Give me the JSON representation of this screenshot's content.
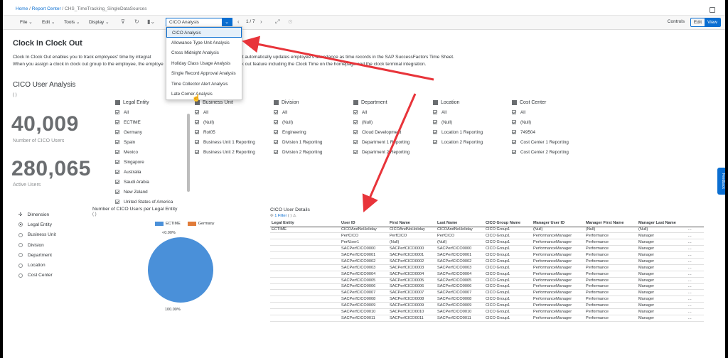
{
  "breadcrumb": {
    "home": "Home",
    "report_center": "Report Center",
    "current": "CHS_TimeTracking_SingleDataSources",
    "sep": "/"
  },
  "toolbar": {
    "file": "File",
    "edit": "Edit",
    "tools": "Tools",
    "display": "Display",
    "story_selected": "CICO Analysis",
    "page": "1 / 7",
    "controls": "Controls",
    "mode_edit": "Edit",
    "mode_view": "View"
  },
  "story_options": [
    "CICO Analysis",
    "Allowance Type Unit Analysis",
    "Cross Midnight Analysis",
    "Holiday Class Usage Analysis",
    "Single Record Approval Analysis",
    "Time Collector Alert Analysis",
    "Late Comer Analysis"
  ],
  "page_title": "Clock In Clock Out",
  "description": {
    "line1": "Clock In Clock Out enables you to track employees' time by integrat",
    "line1b": "vices. It automatically updates employee's attendance as time records in the SAP SuccessFactors Time Sheet.",
    "line2": "When you assign a clock in clock out group to the employee, the employe",
    "line2b": "ock out feature including the Clock Time on the homepage and the clock terminal integration."
  },
  "section_title": "CICO User Analysis",
  "paren": "( )",
  "kpis": [
    {
      "value": "40,009",
      "label": "Number of CICO Users"
    },
    {
      "value": "280,065",
      "label": "Active Users"
    }
  ],
  "filters": [
    {
      "title": "Legal Entity",
      "items": [
        "All",
        "ECTIME",
        "Germany",
        "Spain",
        "Mexico",
        "Singapore",
        "Australia",
        "Saudi Arabia",
        "New Zeland",
        "United States of America"
      ]
    },
    {
      "title": "Business Unit",
      "items": [
        "All",
        "(Null)",
        "Rot05",
        "Business Unit 1 Reporting",
        "Business Unit 2 Reporting"
      ]
    },
    {
      "title": "Division",
      "items": [
        "All",
        "(Null)",
        "Engineering",
        "Division 1 Reporting",
        "Division 2 Reporting"
      ]
    },
    {
      "title": "Department",
      "items": [
        "All",
        "(Null)",
        "Cloud Development",
        "Department 1 Reporting",
        "Department 2 Reporting"
      ]
    },
    {
      "title": "Location",
      "items": [
        "All",
        "(Null)",
        "Location 1 Reporting",
        "Location 2 Reporting"
      ]
    },
    {
      "title": "Cost Center",
      "items": [
        "All",
        "(Null)",
        "749504",
        "Cost Center 1 Reporting",
        "Cost Center 2 Reporting"
      ]
    }
  ],
  "dimension": {
    "title": "Dimension",
    "options": [
      "Legal Entity",
      "Business Unit",
      "Division",
      "Department",
      "Location",
      "Cost Center"
    ],
    "selected": 0
  },
  "chart_data": {
    "type": "pie",
    "title": "Number of CICO Users per Legal Entity",
    "subtitle": "( )",
    "categories": [
      "ECTIME",
      "Germany"
    ],
    "values": [
      100.0,
      0.0
    ],
    "labels": [
      "100.00%",
      "<0.00%"
    ],
    "colors": [
      "#4a90d9",
      "#e07b39"
    ]
  },
  "table": {
    "title": "CICO User Details",
    "filter_text": "1 Filter",
    "columns": [
      "Legal Entity",
      "User ID",
      "First Name",
      "Last Name",
      "CICO Group Name",
      "Manager User ID",
      "Manager First Name",
      "Manager Last Name",
      ""
    ],
    "rows": [
      [
        "ECTIME",
        "CICOAndNoHoliday",
        "CICOAndNoHoliday",
        "CICOAndNoHoliday",
        "CICO Group1",
        "(Null)",
        "(Null)",
        "(Null)",
        "..."
      ],
      [
        "",
        "PerfCICO",
        "PerfCICO",
        "PerfCICO",
        "CICO Group1",
        "PerformanceManager",
        "Performance",
        "Manager",
        "..."
      ],
      [
        "",
        "PerfUser1",
        "(Null)",
        "(Null)",
        "CICO Group1",
        "PerformanceManager",
        "Performance",
        "Manager",
        "..."
      ],
      [
        "",
        "SACPerfCICO0000",
        "SACPerfCICO0000",
        "SACPerfCICO0000",
        "CICO Group1",
        "PerformanceManager",
        "Performance",
        "Manager",
        "..."
      ],
      [
        "",
        "SACPerfCICO0001",
        "SACPerfCICO0001",
        "SACPerfCICO0001",
        "CICO Group1",
        "PerformanceManager",
        "Performance",
        "Manager",
        "..."
      ],
      [
        "",
        "SACPerfCICO0002",
        "SACPerfCICO0002",
        "SACPerfCICO0002",
        "CICO Group1",
        "PerformanceManager",
        "Performance",
        "Manager",
        "..."
      ],
      [
        "",
        "SACPerfCICO0003",
        "SACPerfCICO0003",
        "SACPerfCICO0003",
        "CICO Group1",
        "PerformanceManager",
        "Performance",
        "Manager",
        "..."
      ],
      [
        "",
        "SACPerfCICO0004",
        "SACPerfCICO0004",
        "SACPerfCICO0004",
        "CICO Group1",
        "PerformanceManager",
        "Performance",
        "Manager",
        "..."
      ],
      [
        "",
        "SACPerfCICO0005",
        "SACPerfCICO0005",
        "SACPerfCICO0005",
        "CICO Group1",
        "PerformanceManager",
        "Performance",
        "Manager",
        "..."
      ],
      [
        "",
        "SACPerfCICO0006",
        "SACPerfCICO0006",
        "SACPerfCICO0006",
        "CICO Group1",
        "PerformanceManager",
        "Performance",
        "Manager",
        "..."
      ],
      [
        "",
        "SACPerfCICO0007",
        "SACPerfCICO0007",
        "SACPerfCICO0007",
        "CICO Group1",
        "PerformanceManager",
        "Performance",
        "Manager",
        "..."
      ],
      [
        "",
        "SACPerfCICO0008",
        "SACPerfCICO0008",
        "SACPerfCICO0008",
        "CICO Group1",
        "PerformanceManager",
        "Performance",
        "Manager",
        "..."
      ],
      [
        "",
        "SACPerfCICO0009",
        "SACPerfCICO0009",
        "SACPerfCICO0009",
        "CICO Group1",
        "PerformanceManager",
        "Performance",
        "Manager",
        "..."
      ],
      [
        "",
        "SACPerfCICO0010",
        "SACPerfCICO0010",
        "SACPerfCICO0010",
        "CICO Group1",
        "PerformanceManager",
        "Performance",
        "Manager",
        "..."
      ],
      [
        "",
        "SACPerfCICO0011",
        "SACPerfCICO0011",
        "SACPerfCICO0011",
        "CICO Group1",
        "PerformanceManager",
        "Performance",
        "Manager",
        "..."
      ]
    ]
  },
  "side_tab": "Feedback",
  "colors": {
    "accent": "#0a6ed1",
    "arrow": "#e8343a"
  }
}
